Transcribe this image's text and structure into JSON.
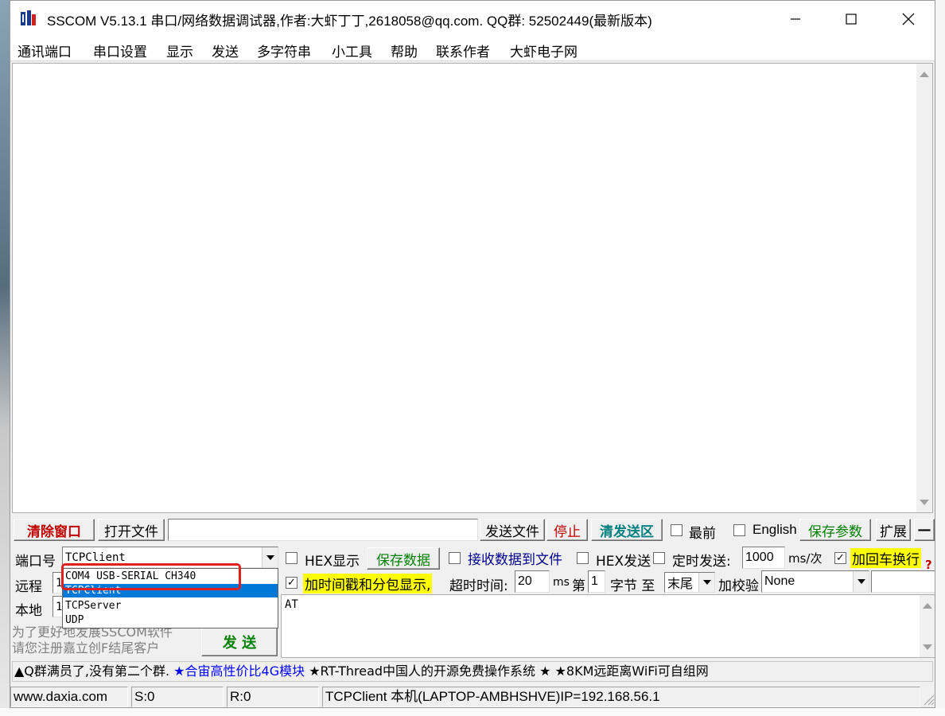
{
  "window": {
    "title": "SSCOM V5.13.1 串口/网络数据调试器,作者:大虾丁丁,2618058@qq.com. QQ群: 52502449(最新版本)"
  },
  "menu": [
    "通讯端口",
    "串口设置",
    "显示",
    "发送",
    "多字符串",
    "小工具",
    "帮助",
    "联系作者",
    "大虾电子网"
  ],
  "toolbar": {
    "clear_window": "清除窗口",
    "open_file": "打开文件",
    "file_path": "",
    "send_file": "发送文件",
    "stop": "停止",
    "clear_send": "清发送区",
    "topmost": "最前",
    "english": "English",
    "save_params": "保存参数",
    "expand": "扩展",
    "collapse": "—"
  },
  "port": {
    "label": "端口号",
    "value": "TCPClient",
    "remote_label": "远程",
    "remote_value": "1",
    "local_label": "本地",
    "local_value": "1",
    "dropdown_options": [
      "COM4 USB-SERIAL CH340",
      "TCPClient",
      "TCPServer",
      "UDP"
    ],
    "selected_option": "TCPClient"
  },
  "promo_text": [
    "为了更好地发展SSCOM软件",
    "请您注册嘉立创F结尾客户"
  ],
  "send_button": "发 送",
  "options_row1": {
    "hex_display": "HEX显示",
    "save_data": "保存数据",
    "recv_to_file": "接收数据到文件",
    "hex_send": "HEX发送",
    "timed_send": "定时发送:",
    "interval": "1000",
    "interval_unit": "ms/次",
    "add_crlf": "加回车换行",
    "help_mark": "?"
  },
  "options_row2": {
    "timestamp": "加时间戳和分包显示,",
    "timeout_label": "超时时间:",
    "timeout": "20",
    "timeout_unit": "ms",
    "nth_label": "第",
    "nth": "1",
    "byte_label": "字节 至",
    "end": "末尾",
    "checksum_label": "加校验",
    "checksum": "None"
  },
  "send_text": "AT",
  "marquee": "▲Q群满员了,没有第二个群. ★合宙高性价比4G模块 ★RT-Thread中国人的开源免费操作系统 ★ ★8KM远距离WiFi可自组网",
  "marquee_parts": [
    "▲Q群满员了,没有第二个群.",
    "★合宙高性价比4G模块",
    "★RT-Thread中国人的开源免费操作系统 ★ ★8KM远距离WiFi可自组网"
  ],
  "status": {
    "site": "www.daxia.com",
    "sent": "S:0",
    "received": "R:0",
    "connection": "TCPClient 本机(LAPTOP-AMBHSHVE)IP=192.168.56.1"
  },
  "colors": {
    "accent_red": "#c00000",
    "accent_green": "#008000",
    "highlight_yellow": "#ffff00",
    "link_blue": "#0000ff",
    "selection_blue": "#0078d7",
    "annotation_red": "#e02020"
  },
  "icons": [
    "sscom-app-icon",
    "minimize-icon",
    "maximize-icon",
    "close-icon",
    "scroll-up-arrow-icon",
    "scroll-down-arrow-icon",
    "dropdown-arrow-icon",
    "resize-grip-icon"
  ]
}
